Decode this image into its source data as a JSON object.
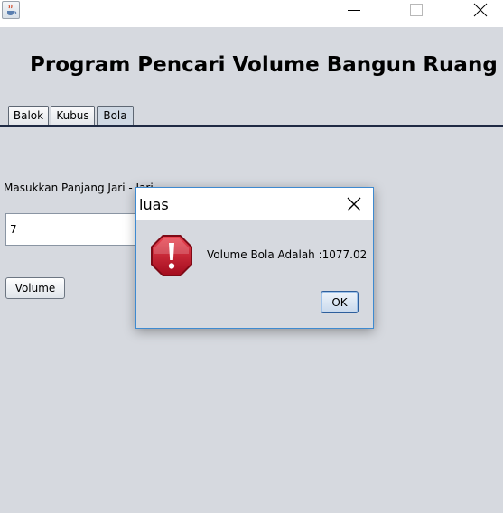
{
  "window": {
    "icon": "java-coffee-cup-icon",
    "controls": [
      "minimize-icon",
      "maximize-icon",
      "close-icon"
    ]
  },
  "heading": "Program Pencari Volume Bangun Ruang",
  "tabs": [
    {
      "label": "Balok",
      "selected": false
    },
    {
      "label": "Kubus",
      "selected": false
    },
    {
      "label": "Bola",
      "selected": true
    }
  ],
  "form": {
    "radius_label": "Masukkan Panjang Jari - Jari",
    "radius_value": "7",
    "volume_button": "Volume"
  },
  "dialog": {
    "title": "luas",
    "icon": "error-icon",
    "message": "Volume Bola Adalah :1077.02",
    "ok_label": "OK",
    "close_icon": "close-icon"
  },
  "colors": {
    "background": "#d6d9df",
    "titlebar": "#ffffff",
    "dialog_border": "#3e8ad0",
    "error_red": "#c8102e"
  }
}
